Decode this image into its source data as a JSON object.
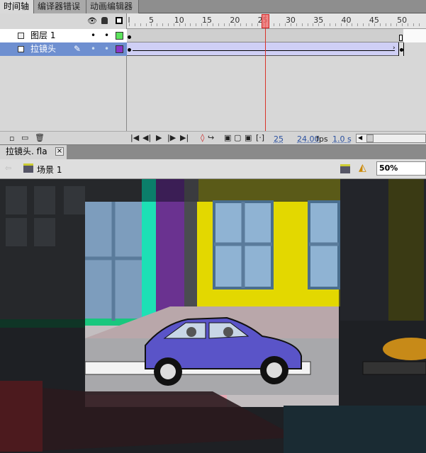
{
  "panel_tabs": [
    {
      "label": "时间轴",
      "active": true
    },
    {
      "label": "编译器错误",
      "active": false
    },
    {
      "label": "动画编辑器",
      "active": false
    }
  ],
  "header_icons": [
    "eye-icon",
    "lock-icon",
    "outline-icon"
  ],
  "ruler": {
    "labels": [
      "l",
      "5",
      "10",
      "15",
      "20",
      "25",
      "30",
      "35",
      "40",
      "45",
      "50"
    ],
    "current_frame": 25,
    "total_frames": 50
  },
  "layers": [
    {
      "name": "图层 1",
      "color": "#5de35d",
      "selected": false
    },
    {
      "name": "拉镜头",
      "color": "#8a35c8",
      "selected": true
    }
  ],
  "status": {
    "frame": "25",
    "fps": "24.00",
    "fps_unit": "fps",
    "time": "1.0 s"
  },
  "document_tab": {
    "label": "拉镜头. fla",
    "close": "×"
  },
  "scene": {
    "label": "场景 1",
    "zoom": "50%"
  },
  "colors": {
    "selected_row": "#6e8fd0",
    "frame_span": "#cfcff5",
    "playhead": "#d9332a"
  }
}
